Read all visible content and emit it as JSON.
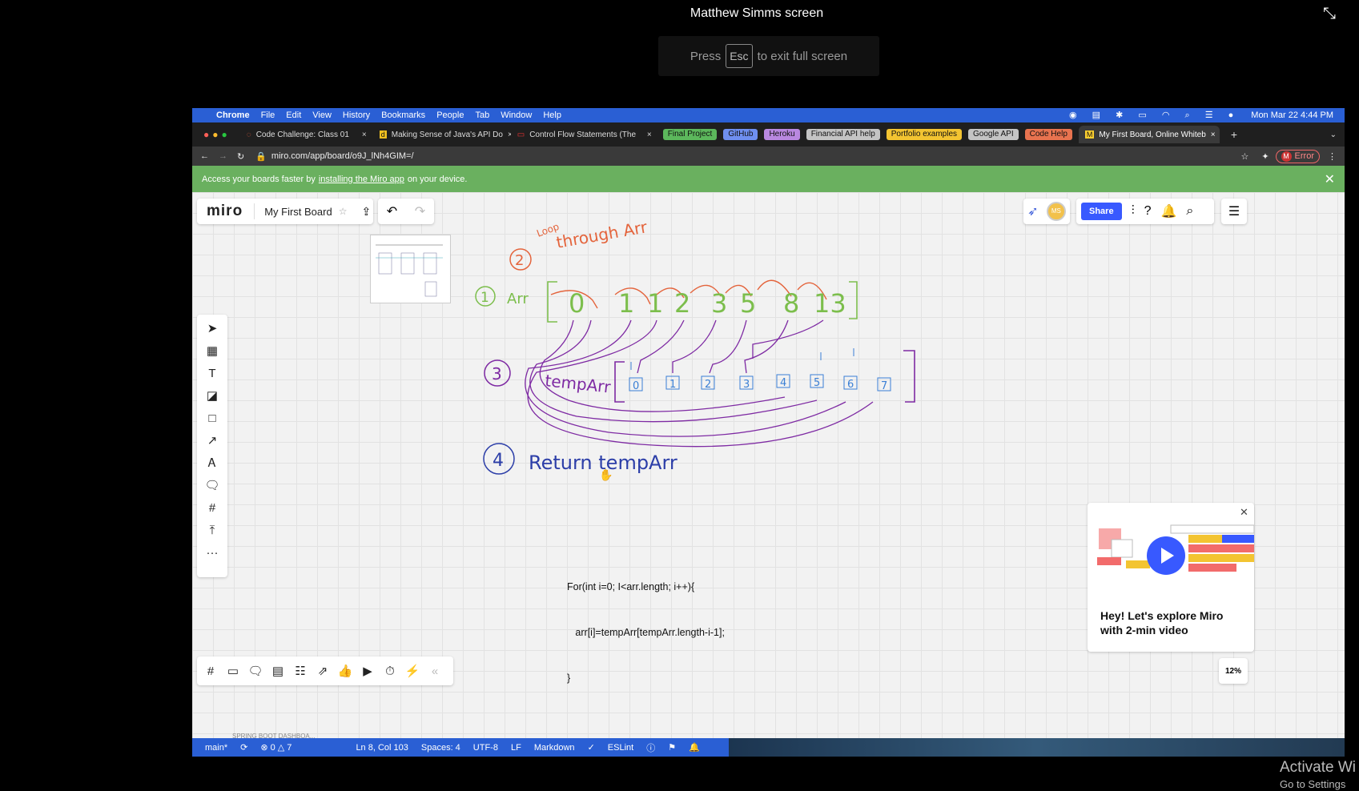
{
  "share": {
    "title": "Matthew Simms screen",
    "esc_press": "Press",
    "esc_key": "Esc",
    "esc_text": "to exit full screen"
  },
  "menubar": {
    "items": [
      "Chrome",
      "File",
      "Edit",
      "View",
      "History",
      "Bookmarks",
      "People",
      "Tab",
      "Window",
      "Help"
    ],
    "clock": "Mon Mar 22  4:44 PM"
  },
  "tabs": [
    {
      "label": "Code Challenge: Class 01",
      "icon": "github-icon"
    },
    {
      "label": "Making Sense of Java's API Do",
      "icon": "d-icon"
    },
    {
      "label": "Control Flow Statements (The",
      "icon": "oracle-icon"
    }
  ],
  "bookmarks": [
    {
      "label": "Final Project",
      "color": "#5cb85c"
    },
    {
      "label": "GitHub",
      "color": "#6f8ff0"
    },
    {
      "label": "Heroku",
      "color": "#b988e0"
    },
    {
      "label": "Financial API help",
      "color": "#c4c4c4"
    },
    {
      "label": "Portfolio examples",
      "color": "#f3c431"
    },
    {
      "label": "Google API",
      "color": "#c4c4c4"
    },
    {
      "label": "Code Help",
      "color": "#e8734f"
    }
  ],
  "active_tab": "My First Board, Online Whiteb",
  "url": "miro.com/app/board/o9J_lNh4GIM=/",
  "error_label": "Error",
  "profile_initial": "M",
  "banner": {
    "prefix": "Access your boards faster by",
    "link": "installing the Miro app",
    "suffix": "on your device."
  },
  "miro": {
    "logo": "miro",
    "board_name": "My First Board",
    "share_label": "Share",
    "avatar": "MS",
    "zoom": "12%",
    "promo_text": "Hey! Let's explore Miro with 2-min video"
  },
  "sketch": {
    "step2": "2",
    "loop_label": "Loop",
    "through_label": "through Arr",
    "step1": "1",
    "arr_label": "Arr",
    "arr_values": [
      "0",
      "1",
      "1",
      "2",
      "3",
      "5",
      "8",
      "13"
    ],
    "step3": "3",
    "temp_label": "tempArr",
    "temp_indices": [
      "0",
      "1",
      "2",
      "3",
      "4",
      "5",
      "6",
      "7"
    ],
    "step4": "4",
    "return_text": "Return  tempArr"
  },
  "code": [
    "For(int i=0; I<arr.length; i++){",
    "   arr[i]=tempArr[tempArr.length-i-1];",
    "}"
  ],
  "statusbar": {
    "branch": "main*",
    "errors": "⊗ 0 △ 7",
    "position": "Ln 8, Col 103",
    "spaces": "Spaces: 4",
    "encoding": "UTF-8",
    "eol": "LF",
    "language": "Markdown",
    "lint": "ESLint",
    "faded": "SPRING BOOT DASHBOA..."
  },
  "activate": {
    "title": "Activate Wi",
    "subtitle": "Go to Settings"
  }
}
